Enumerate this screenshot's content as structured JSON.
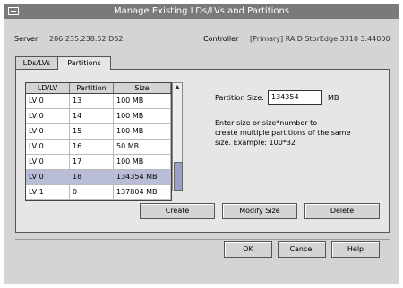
{
  "window": {
    "title": "Manage Existing LDs/LVs and Partitions"
  },
  "server": {
    "label": "Server",
    "value": "206.235.238.52 DS2"
  },
  "controller": {
    "label": "Controller",
    "value": "[Primary] RAID StorEdge 3310 3.44000"
  },
  "tabs": [
    {
      "label": "LDs/LVs"
    },
    {
      "label": "Partitions"
    }
  ],
  "table": {
    "headers": [
      "LD/LV",
      "Partition",
      "Size"
    ],
    "rows": [
      [
        "LV 0",
        "13",
        "100 MB"
      ],
      [
        "LV 0",
        "14",
        "100 MB"
      ],
      [
        "LV 0",
        "15",
        "100 MB"
      ],
      [
        "LV 0",
        "16",
        "50 MB"
      ],
      [
        "LV 0",
        "17",
        "100 MB"
      ],
      [
        "LV 0",
        "18",
        "134354 MB"
      ],
      [
        "LV 1",
        "0",
        "137804 MB"
      ]
    ]
  },
  "partition": {
    "label": "Partition Size:",
    "value": "134354",
    "unit": "MB",
    "help": [
      "Enter size or size*number to",
      "create multiple partitions of the same",
      "size. Example: 100*32"
    ]
  },
  "buttons": {
    "create": "Create",
    "modify": "Modify Size",
    "delete": "Delete",
    "ok": "OK",
    "cancel": "Cancel",
    "help": "Help"
  }
}
